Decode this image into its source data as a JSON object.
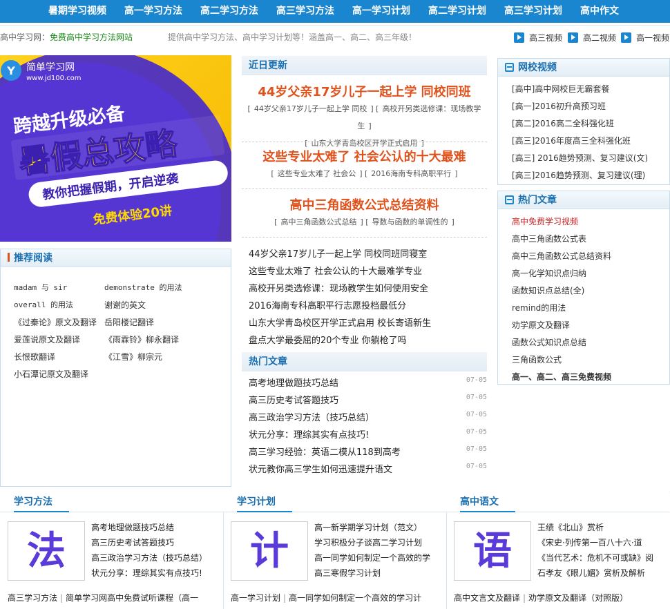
{
  "nav": [
    "暑期学习视频",
    "高一学习方法",
    "高二学习方法",
    "高三学习方法",
    "高一学习计划",
    "高二学习计划",
    "高三学习计划",
    "高中作文"
  ],
  "intro": {
    "site": "高中学习网：",
    "site_em": "免费高中学习方法网站",
    "desc": "提供高中学习方法、高中学习计划等！涵盖高一、高二、高三年级！"
  },
  "video_links": [
    "高三视频",
    "高二视频",
    "高一视频"
  ],
  "banner": {
    "logo_cn": "简单学习网",
    "logo_url": "www.jd100.com",
    "line1": "跨越升级必备",
    "line2": "暑假总攻略",
    "line3": "教你把握假期，开启逆袭",
    "line4": "免费体验20讲"
  },
  "recommend": {
    "title": "推荐阅读",
    "left": [
      "madam 与 sir",
      "overall 的用法",
      "《过秦论》原文及翻译",
      "爱莲说原文及翻译",
      "长恨歌翻译",
      "小石潭记原文及翻译"
    ],
    "right": [
      "demonstrate 的用法",
      "谢谢的英文",
      "岳阳楼记翻译",
      "《雨霖铃》柳永翻译",
      "《江雪》柳宗元"
    ]
  },
  "recent": {
    "title": "近日更新",
    "headlines": [
      {
        "title": "44岁父亲17岁儿子一起上学 同校同班",
        "subs": [
          "44岁父亲17岁儿子一起上学 同校",
          "高校开另类选修课：现场教学生",
          "山东大学青岛校区开学正式启用"
        ]
      },
      {
        "title": "这些专业太难了 社会公认的十大最难",
        "subs": [
          "这些专业太难了 社会公",
          "2016海南专科高职平行"
        ]
      },
      {
        "title": "高中三角函数公式总结资料",
        "subs": [
          "高中三角函数公式总结",
          "导数与函数的单调性的"
        ]
      }
    ],
    "list": [
      "44岁父亲17岁儿子一起上学 同校同班同寝室",
      "这些专业太难了 社会公认的十大最难学专业",
      "高校开另类选修课：现场教学生如何使用安全",
      "2016海南专科高职平行志愿投档最低分",
      "山东大学青岛校区开学正式启用 校长寄语新生",
      "盘点大学最委屈的20个专业 你躺枪了吗"
    ]
  },
  "hot_center": {
    "title": "热门文章",
    "rows": [
      {
        "text": "高考地理做题技巧总结",
        "date": "07-05"
      },
      {
        "text": "高三历史考试答题技巧",
        "date": "07-05"
      },
      {
        "text": "高三政治学习方法（技巧总结）",
        "date": "07-05"
      },
      {
        "text": "状元分享：理综其实有点技巧!",
        "date": "07-05"
      },
      {
        "text": "高三学习经验：英语二模从118到高考",
        "date": "07-05"
      },
      {
        "text": "状元教你高三学生如何迅速提升语文",
        "date": "07-05"
      }
    ]
  },
  "school_video": {
    "title": "网校视频",
    "items": [
      "[高中]高中网校巨无霸套餐",
      "[高一]2016初升高预习班",
      "[高二]2016高二全科强化班",
      "[高三]2016年度高三全科强化班",
      "[高三] 2016趋势预测、复习建议(文)",
      "[高三]2016趋势预测、复习建议(理)"
    ]
  },
  "hot_right": {
    "title": "热门文章",
    "items": [
      "高中免费学习视频",
      "高中三角函数公式表",
      "高中三角函数公式总结资料",
      "高一化学知识点归纳",
      "函数知识点总结(全)",
      "remind的用法",
      "劝学原文及翻译",
      "函数公式知识点总结",
      "三角函数公式",
      "高一、高二、高三免费视频"
    ]
  },
  "bottom": [
    {
      "title": "学习方法",
      "glyph": "法",
      "items": [
        "高考地理做题技巧总结",
        "高三历史考试答题技巧",
        "高三政治学习方法（技巧总结）",
        "状元分享：理综其实有点技巧!"
      ],
      "foot": [
        "高三学习方法",
        "简单学习网高中免费试听课程（高一"
      ]
    },
    {
      "title": "学习计划",
      "glyph": "计",
      "items": [
        "高一新学期学习计划（范文）",
        "学习积极分子谈高二学习计划",
        "高一同学如何制定一个高效的学",
        "高三寒假学习计划"
      ],
      "foot": [
        "高一学习计划",
        "高一同学如何制定一个高效的学习计"
      ]
    },
    {
      "title": "高中语文",
      "glyph": "语",
      "items": [
        "王绩《北山》赏析",
        "《宋史·列传第一百八十六·道",
        "《当代艺术：危机不可或缺》阅",
        "石孝友《眼儿媚》赏析及解析"
      ],
      "foot": [
        "高中文言文及翻译",
        "劝学原文及翻译（对照版）"
      ]
    }
  ],
  "colors": {
    "brand": "#1a86cf",
    "headline": "#e0521c",
    "accent_red": "#c81e1e"
  }
}
